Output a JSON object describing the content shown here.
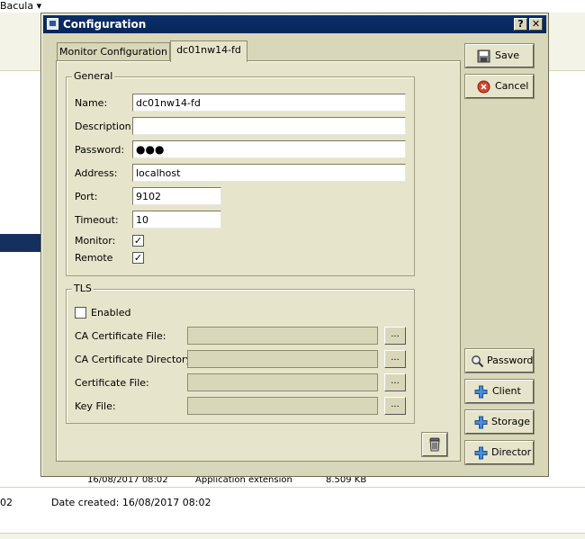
{
  "background": {
    "menu_label": "Bacula ▾",
    "row": {
      "date": "16/08/2017 08:02",
      "type": "Application extension",
      "size": "8.509 KB"
    },
    "status": {
      "left_fragment": "02",
      "date_created": "Date created: 16/08/2017 08:02"
    }
  },
  "dialog": {
    "title": "Configuration",
    "help_label": "?",
    "close_label": "✕",
    "tabs": [
      {
        "label": "Monitor Configuration"
      },
      {
        "label": "dc01nw14-fd"
      }
    ],
    "general": {
      "legend": "General",
      "name_label": "Name:",
      "name_value": "dc01nw14-fd",
      "description_label": "Description:",
      "description_value": "",
      "password_label": "Password:",
      "password_value": "●●●",
      "address_label": "Address:",
      "address_value": "localhost",
      "port_label": "Port:",
      "port_value": "9102",
      "timeout_label": "Timeout:",
      "timeout_value": "10",
      "monitor_label": "Monitor:",
      "monitor_mark": "✓",
      "remote_label": "Remote",
      "remote_mark": "✓"
    },
    "tls": {
      "legend": "TLS",
      "enabled_label": "Enabled",
      "ca_file_label": "CA Certificate File:",
      "ca_dir_label": "CA Certificate Directory:",
      "cert_file_label": "Certificate File:",
      "key_file_label": "Key File:",
      "browse_label": "..."
    },
    "buttons": {
      "save": "Save",
      "cancel": "Cancel",
      "password": "Password",
      "client": "Client",
      "storage": "Storage",
      "director": "Director"
    }
  }
}
